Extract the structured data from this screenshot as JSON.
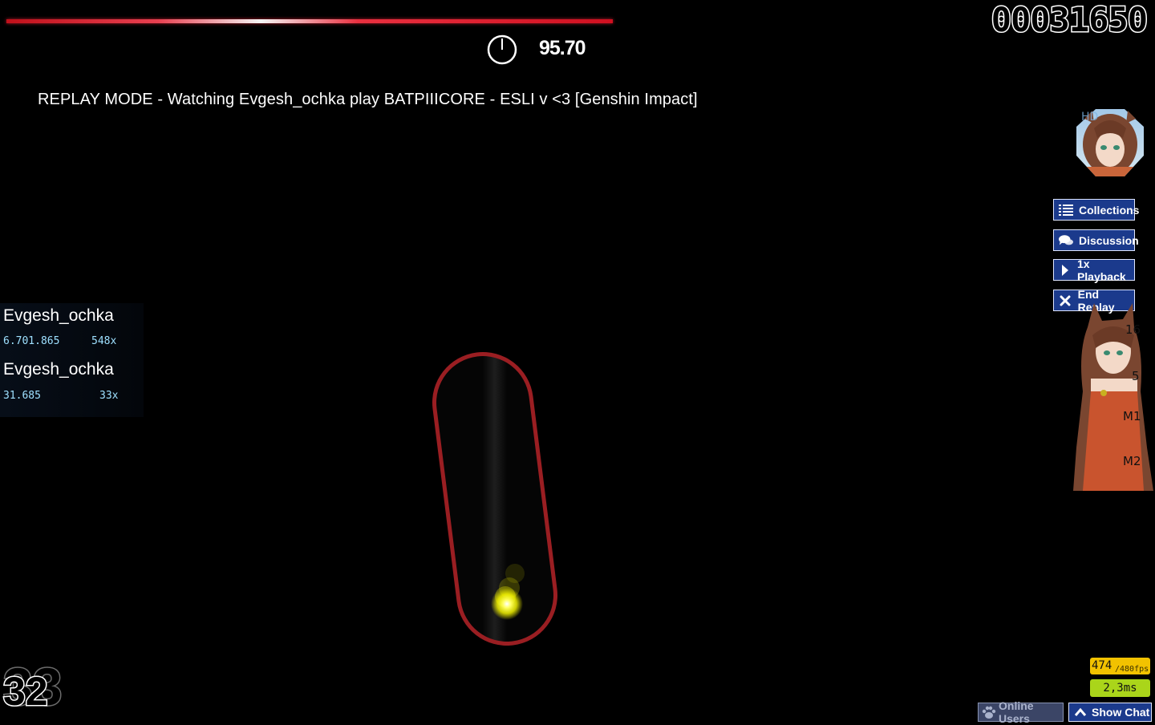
{
  "hud": {
    "score": "00031650",
    "accuracy": "95.70",
    "health_percent": 100,
    "combo": "32",
    "combo_ghost": "33"
  },
  "replay_banner": "REPLAY MODE - Watching Evgesh_ochka play BATPIIICORE - ESLI v <3 [Genshin Impact]",
  "leaderboard": [
    {
      "name": "Evgesh_ochka",
      "score": "6.701.865",
      "combo": "548x"
    },
    {
      "name": "Evgesh_ochka",
      "score": "31.685",
      "combo": "33x"
    }
  ],
  "side_buttons": {
    "collections": "Collections",
    "discussion": "Discussion",
    "playback": "1x Playback",
    "end_replay": "End Replay"
  },
  "key_counters": {
    "k1": "16",
    "k2": "5",
    "m1": "M1",
    "m2": "M2"
  },
  "performance": {
    "fps": "474",
    "fps_limit": "/480fps",
    "latency": "2,3ms"
  },
  "bottom_bar": {
    "online_users": "Online Users",
    "show_chat": "Show Chat"
  },
  "colors": {
    "slider_border": "#9a1e22",
    "cursor": "#ffff33",
    "button_bg": "#1b3a8c",
    "fps_bg": "#f2c200",
    "latency_bg": "#aad51a"
  },
  "icons": [
    "clock-icon",
    "list-icon",
    "chat-bubbles-icon",
    "play-arrow-icon",
    "close-x-icon",
    "paw-icon",
    "chevron-up-icon"
  ]
}
